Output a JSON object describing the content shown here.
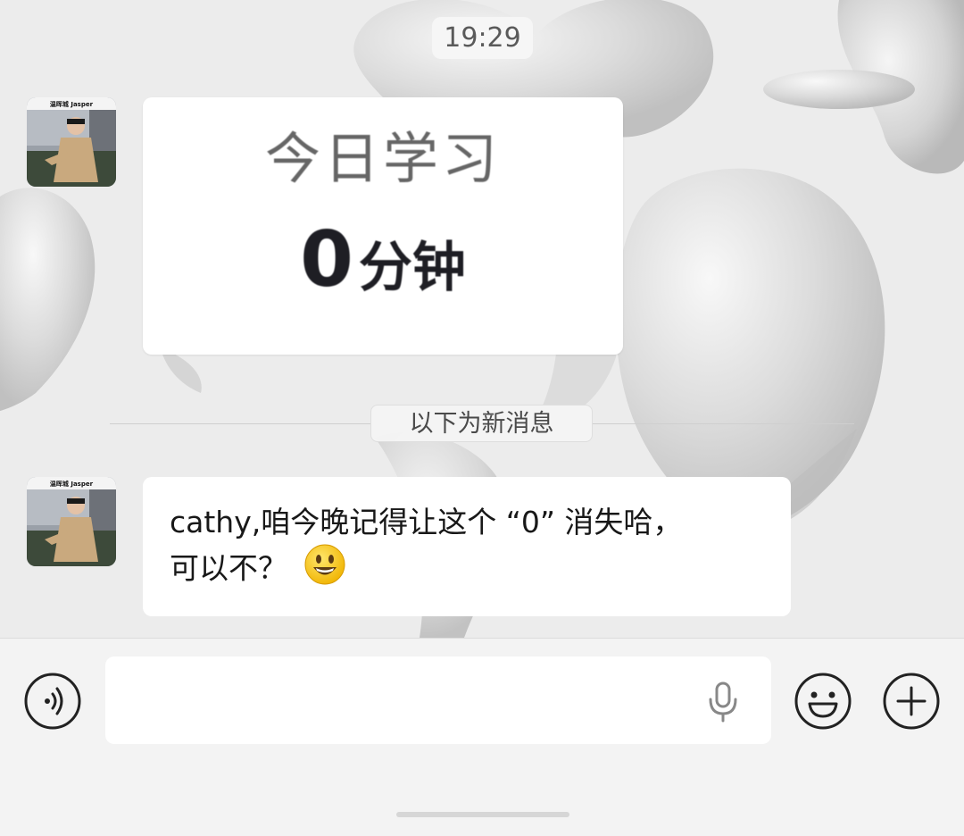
{
  "chat": {
    "timestamp": "19:29",
    "new_messages_divider": "以下为新消息",
    "messages": [
      {
        "type": "image",
        "sender_avatar_label": "温晖城 Jasper",
        "image_text_line1": "今日学习",
        "image_number": "0",
        "image_unit": "分钟"
      },
      {
        "type": "text",
        "sender_avatar_label": "温晖城 Jasper",
        "text_line1": "cathy,咱今晚记得让这个 “0” 消失哈，",
        "text_line2": "可以不？",
        "emoji": "smiley-face-emoji"
      }
    ]
  },
  "input_bar": {
    "placeholder": "",
    "voice_icon": "voice-mode-icon",
    "mic_icon": "microphone-icon",
    "emoji_icon": "emoji-icon",
    "plus_icon": "plus-icon"
  },
  "colors": {
    "chat_background": "#e9e9e9",
    "bubble_background": "#ffffff",
    "input_bar_background": "#f3f3f3",
    "icon_color": "#222222",
    "emoji_yellow": "#f8c81c"
  }
}
